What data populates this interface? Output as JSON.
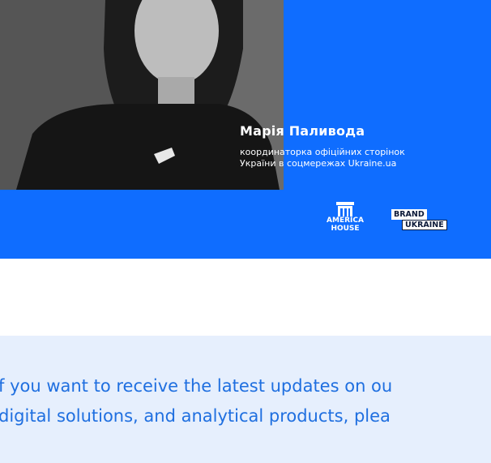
{
  "banner": {
    "name": "Марія Паливода",
    "role_line1": "координаторка офіційних сторінок",
    "role_line2": "України в соцмережах Ukraine.ua",
    "logo_america_house_line1": "AMERICA",
    "logo_america_house_line2": "HOUSE",
    "logo_brand_ukraine_top": "BRAND",
    "logo_brand_ukraine_bottom": "UKRAINE",
    "accent_color": "#0f6dff"
  },
  "subscribe": {
    "line1": "f you want to receive the latest updates on ou",
    "line2": "digital solutions, and analytical products, plea",
    "text_color": "#1f6fe0",
    "background": "#e6effd"
  }
}
